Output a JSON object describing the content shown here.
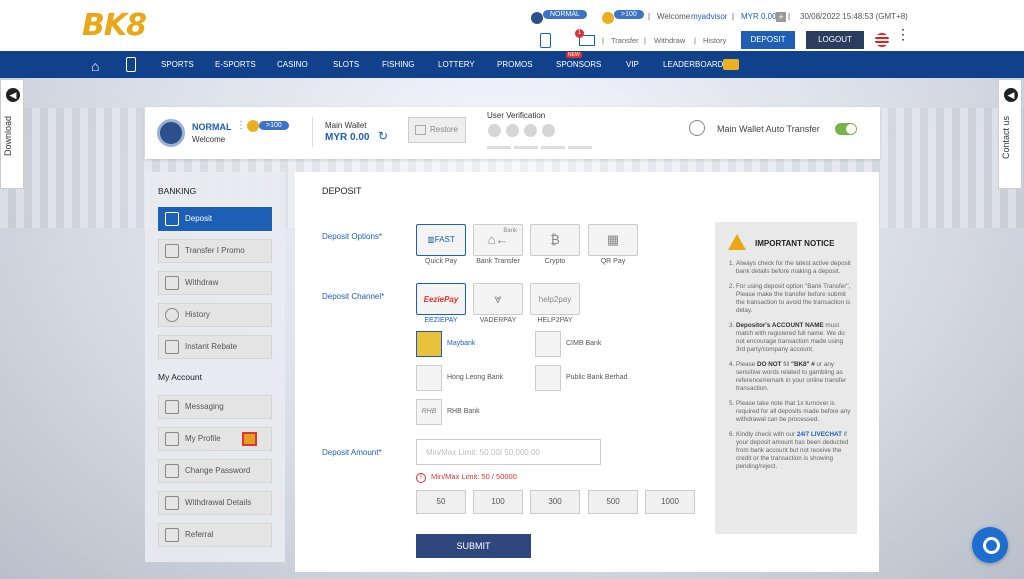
{
  "header": {
    "logo_a": "BK",
    "logo_b": "8",
    "level": "NORMAL",
    "points": ">100",
    "welcome": "Welcome",
    "username": "myadvisor",
    "balance": "MYR 0.00",
    "datetime": "30/08/2022 15:48:53 (GMT+8)",
    "links": [
      "Transfer",
      "Withdraw",
      "History"
    ],
    "deposit": "DEPOSIT",
    "logout": "LOGOUT",
    "notif_count": "1"
  },
  "nav": {
    "items": [
      "SPORTS",
      "E-SPORTS",
      "CASINO",
      "SLOTS",
      "FISHING",
      "LOTTERY",
      "PROMOS",
      "SPONSORS",
      "VIP",
      "LEADERBOARD"
    ],
    "new_badge": "NEW"
  },
  "side": {
    "left": "Download",
    "right": "Contact us"
  },
  "profile": {
    "level": "NORMAL",
    "points": ">100",
    "welcome": "Welcome",
    "wallet_label": "Main Wallet",
    "wallet_value": "MYR 0.00",
    "restore": "Restore",
    "verification": "User Verification",
    "auto_transfer": "Main Wallet Auto Transfer"
  },
  "left": {
    "banking": "BANKING",
    "banking_items": [
      "Deposit",
      "Transfer I Promo",
      "Withdraw",
      "History",
      "Instant Rebate"
    ],
    "account": "My Account",
    "account_items": [
      "Messaging",
      "My Profile",
      "Change Password",
      "Withdrawal Details",
      "Referral"
    ]
  },
  "main": {
    "title": "DEPOSIT",
    "options_label": "Deposit Options*",
    "options": [
      "Quick Pay",
      "Bank Transfer",
      "Crypto",
      "QR Pay"
    ],
    "channel_label": "Deposit Channel*",
    "channels": [
      "EEZIEPAY",
      "VADERPAY",
      "HELP2PAY"
    ],
    "channel_logos": [
      "EeziePay",
      "",
      "help2pay"
    ],
    "banks": [
      "Maybank",
      "CIMB Bank",
      "Hong Leong Bank",
      "Public Bank Berhad",
      "RHB Bank"
    ],
    "amount_label": "Deposit Amount*",
    "amount_placeholder": "Min/Max Limit: 50.00/ 50,000.00",
    "limit_error": "Min/Max Limit: 50 / 50000",
    "quick_amounts": [
      "50",
      "100",
      "300",
      "500",
      "1000"
    ],
    "submit": "SUBMIT",
    "fast": "FAST",
    "bank_word": "Bank",
    "rhb": "RHB"
  },
  "notice": {
    "title": "IMPORTANT NOTICE"
  }
}
